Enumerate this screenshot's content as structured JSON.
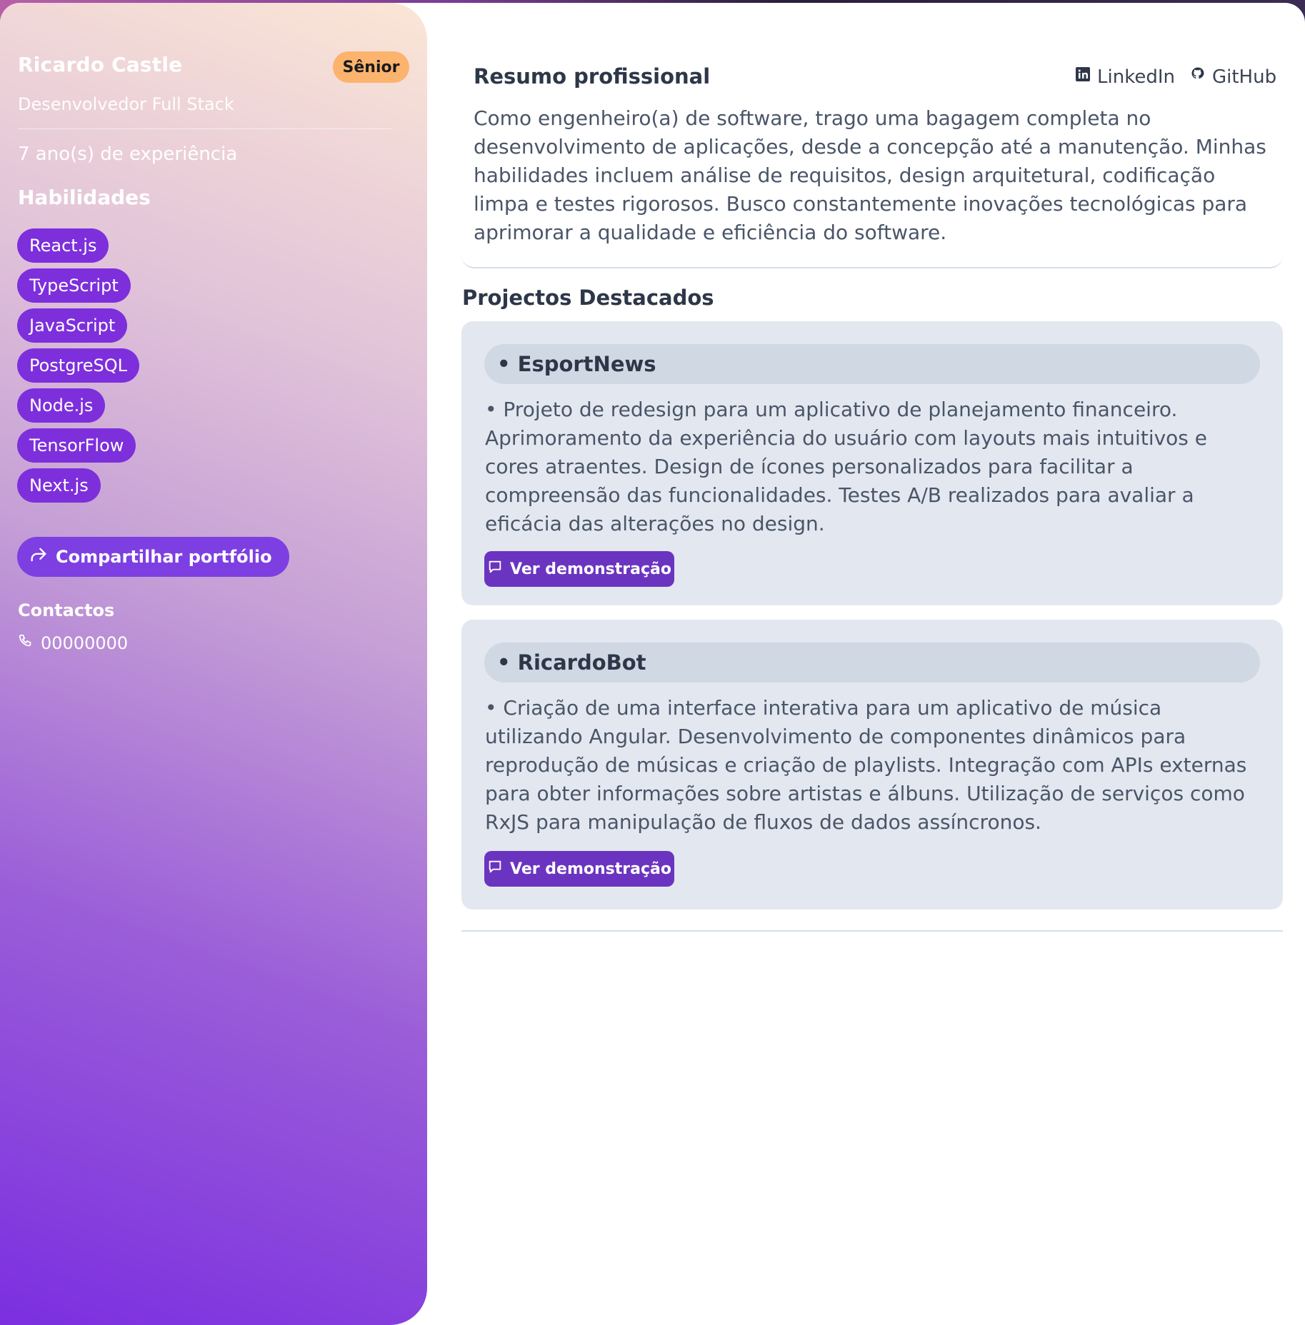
{
  "profile": {
    "name": "Ricardo Castle",
    "level": "Sênior",
    "role": "Desenvolvedor Full Stack",
    "experience": "7 ano(s) de experiência"
  },
  "skills": {
    "title": "Habilidades",
    "items": [
      "React.js",
      "TypeScript",
      "JavaScript",
      "PostgreSQL",
      "Node.js",
      "TensorFlow",
      "Next.js"
    ]
  },
  "share": {
    "label": "Compartilhar portfólio",
    "icon": "share-icon"
  },
  "contacts": {
    "title": "Contactos",
    "phone": "00000000",
    "phone_icon": "phone-icon"
  },
  "summary": {
    "title": "Resumo profissional",
    "text": "Como engenheiro(a) de software, trago uma bagagem completa no desenvolvimento de aplicações, desde a concepção até a manutenção. Minhas habilidades incluem análise de requisitos, design arquitetural, codificação limpa e testes rigorosos. Busco constantemente inovações tecnológicas para aprimorar a qualidade e eficiência do software."
  },
  "links": {
    "linkedin": "LinkedIn",
    "github": "GitHub"
  },
  "projects": {
    "title": "Projectos Destacados",
    "items": [
      {
        "name": "• EsportNews",
        "description": "• Projeto de redesign para um aplicativo de planejamento financeiro. Aprimoramento da experiência do usuário com layouts mais intuitivos e cores atraentes. Design de ícones personalizados para facilitar a compreensão das funcionalidades. Testes A/B realizados para avaliar a eficácia das alterações no design.",
        "button": "Ver demonstração"
      },
      {
        "name": "• RicardoBot",
        "description": "• Criação de uma interface interativa para um aplicativo de música utilizando Angular. Desenvolvimento de componentes dinâmicos para reprodução de músicas e criação de playlists. Integração com APIs externas para obter informações sobre artistas e álbuns. Utilização de serviços como RxJS para manipulação de fluxos de dados assíncronos.",
        "button": "Ver demonstração"
      }
    ]
  },
  "colors": {
    "accent": "#7d2fdc",
    "badge": "#fcb36e",
    "button": "#6b34c0",
    "card": "#e3e8f0"
  }
}
